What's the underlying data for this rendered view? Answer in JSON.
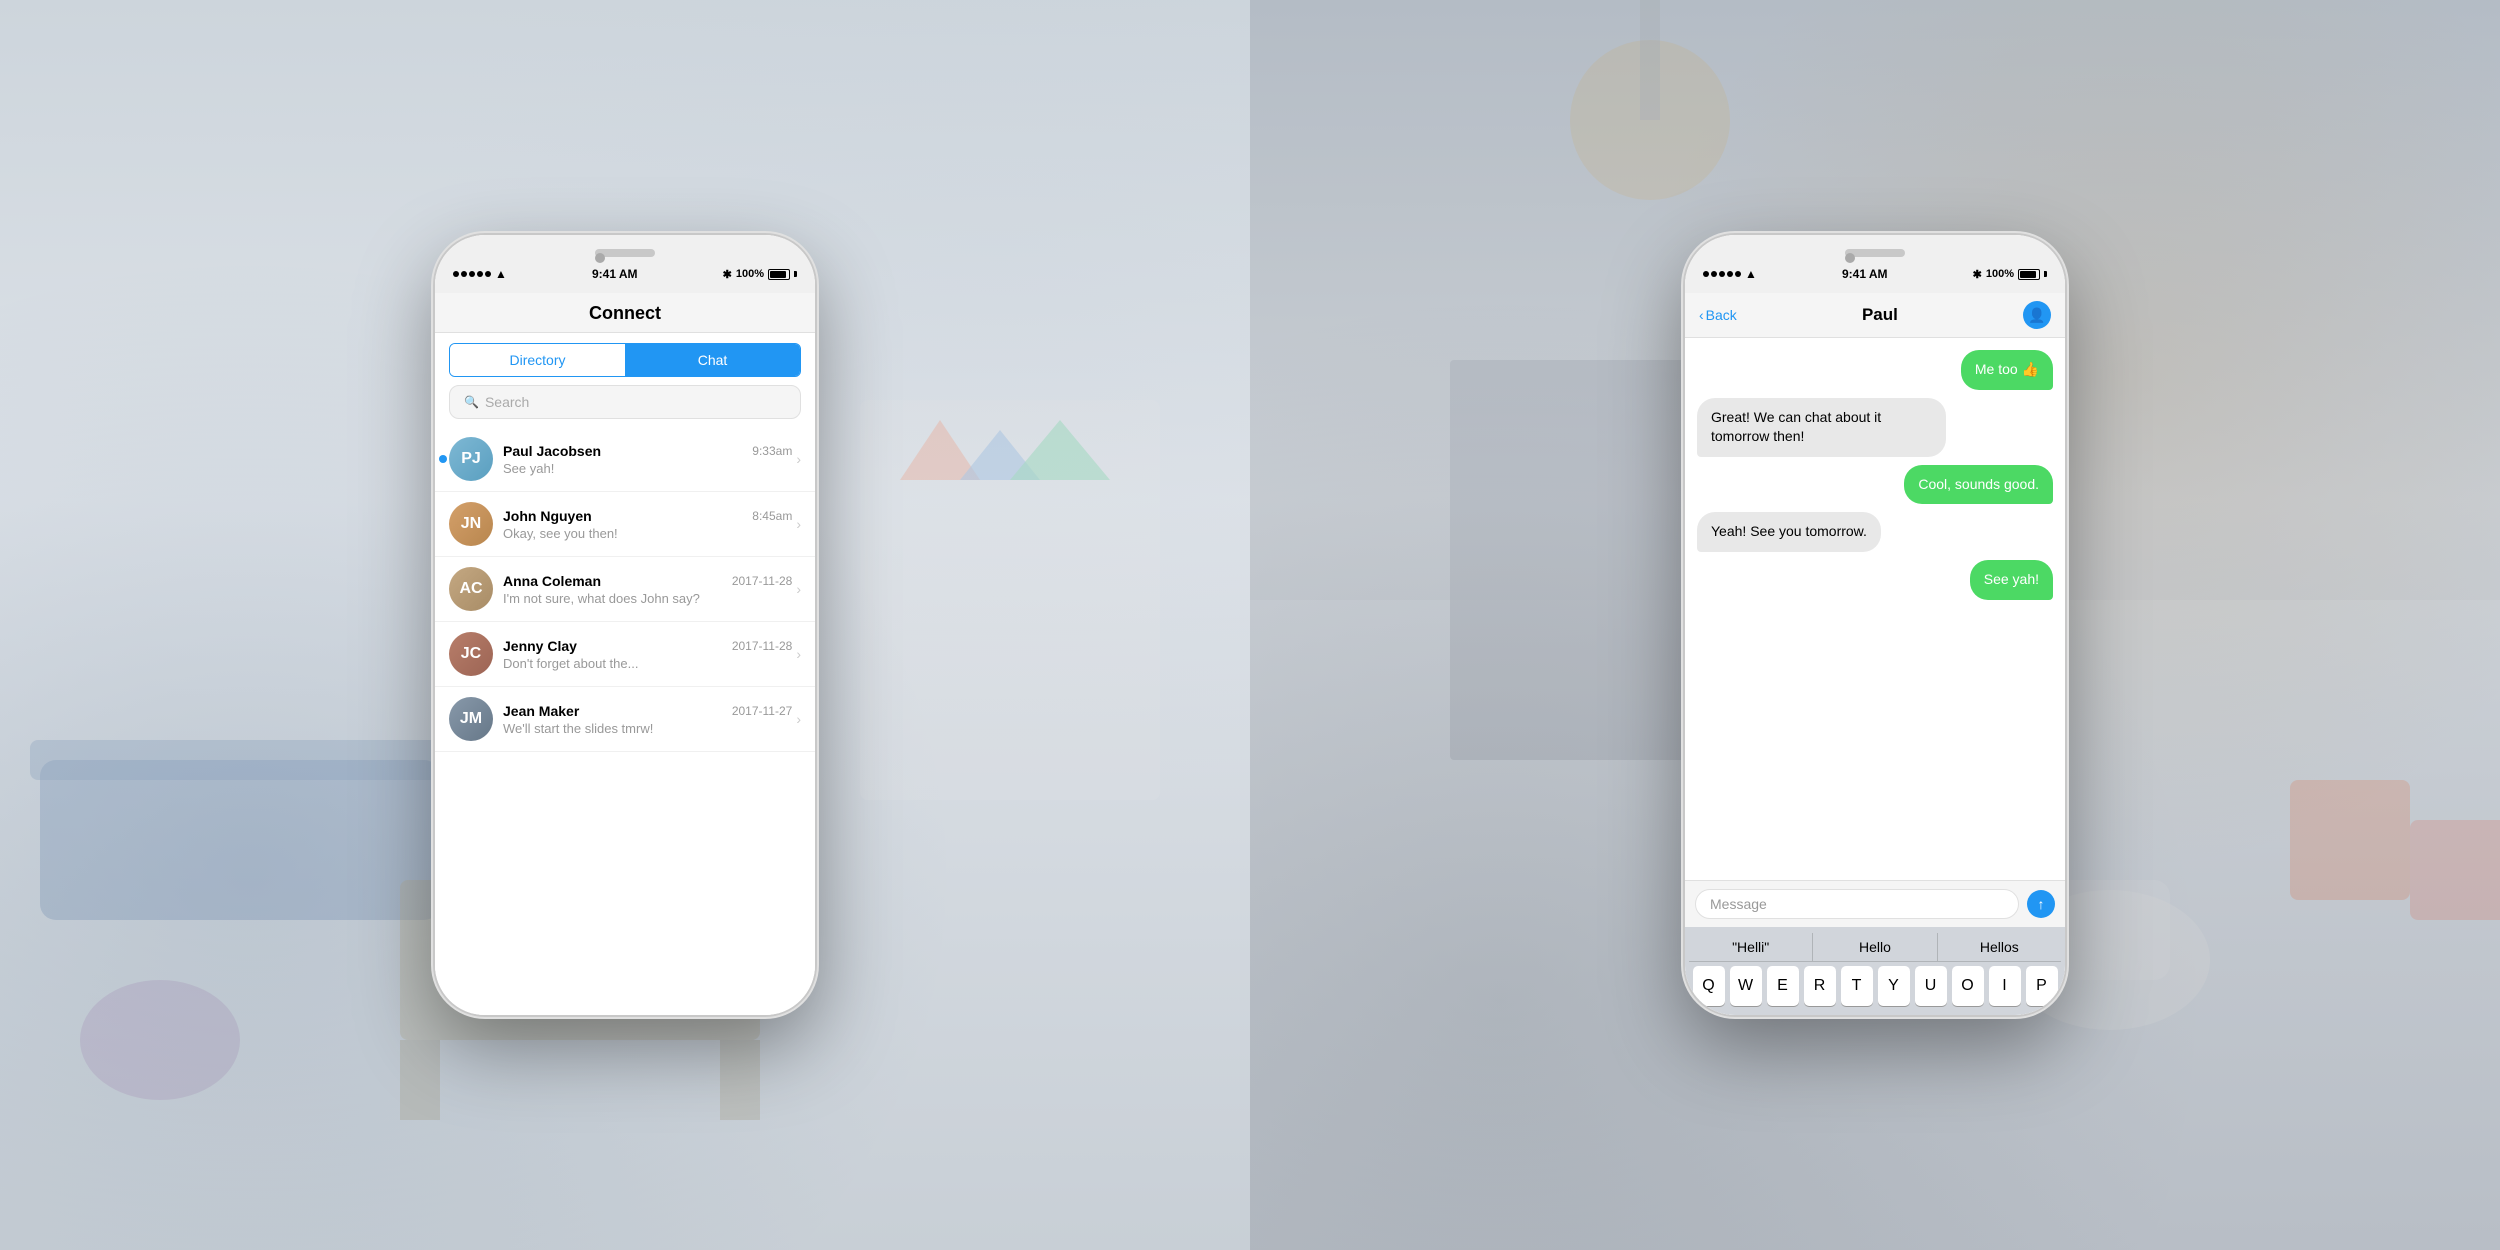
{
  "left_phone": {
    "status_bar": {
      "signal": "●●●●●",
      "wifi": "WiFi",
      "time": "9:41 AM",
      "bluetooth": "BT",
      "battery": "100%"
    },
    "header": {
      "title": "Connect"
    },
    "tabs": {
      "directory": "Directory",
      "chat": "Chat"
    },
    "search": {
      "placeholder": "Search"
    },
    "chat_list": [
      {
        "name": "Paul Jacobsen",
        "time": "9:33am",
        "preview": "See yah!",
        "unread": true,
        "avatar_initials": "PJ",
        "avatar_class": "avatar-paul"
      },
      {
        "name": "John Nguyen",
        "time": "8:45am",
        "preview": "Okay, see you then!",
        "unread": false,
        "avatar_initials": "JN",
        "avatar_class": "avatar-john"
      },
      {
        "name": "Anna Coleman",
        "time": "2017-11-28",
        "preview": "I'm not sure, what does John say?",
        "unread": false,
        "avatar_initials": "AC",
        "avatar_class": "avatar-anna"
      },
      {
        "name": "Jenny Clay",
        "time": "2017-11-28",
        "preview": "Don't forget about the...",
        "unread": false,
        "avatar_initials": "JC",
        "avatar_class": "avatar-jenny"
      },
      {
        "name": "Jean Maker",
        "time": "2017-11-27",
        "preview": "We'll start the slides tmrw!",
        "unread": false,
        "avatar_initials": "JM",
        "avatar_class": "avatar-jean"
      }
    ]
  },
  "right_phone": {
    "status_bar": {
      "signal": "●●●●●",
      "wifi": "WiFi",
      "time": "9:41 AM",
      "bluetooth": "BT",
      "battery": "100%"
    },
    "header": {
      "back_label": "Back",
      "contact_name": "Paul"
    },
    "messages": [
      {
        "text": "Me too 👍",
        "type": "sent"
      },
      {
        "text": "Great! We can chat about it tomorrow then!",
        "type": "received"
      },
      {
        "text": "Cool, sounds good.",
        "type": "sent"
      },
      {
        "text": "Yeah! See you tomorrow.",
        "type": "received"
      },
      {
        "text": "See yah!",
        "type": "sent"
      }
    ],
    "input_placeholder": "Message",
    "keyboard": {
      "suggestions": [
        "\"Helli\"",
        "Hello",
        "Hellos"
      ],
      "row1": [
        "Q",
        "W",
        "E",
        "R",
        "T",
        "Y",
        "U",
        "O",
        "I",
        "P"
      ]
    }
  }
}
